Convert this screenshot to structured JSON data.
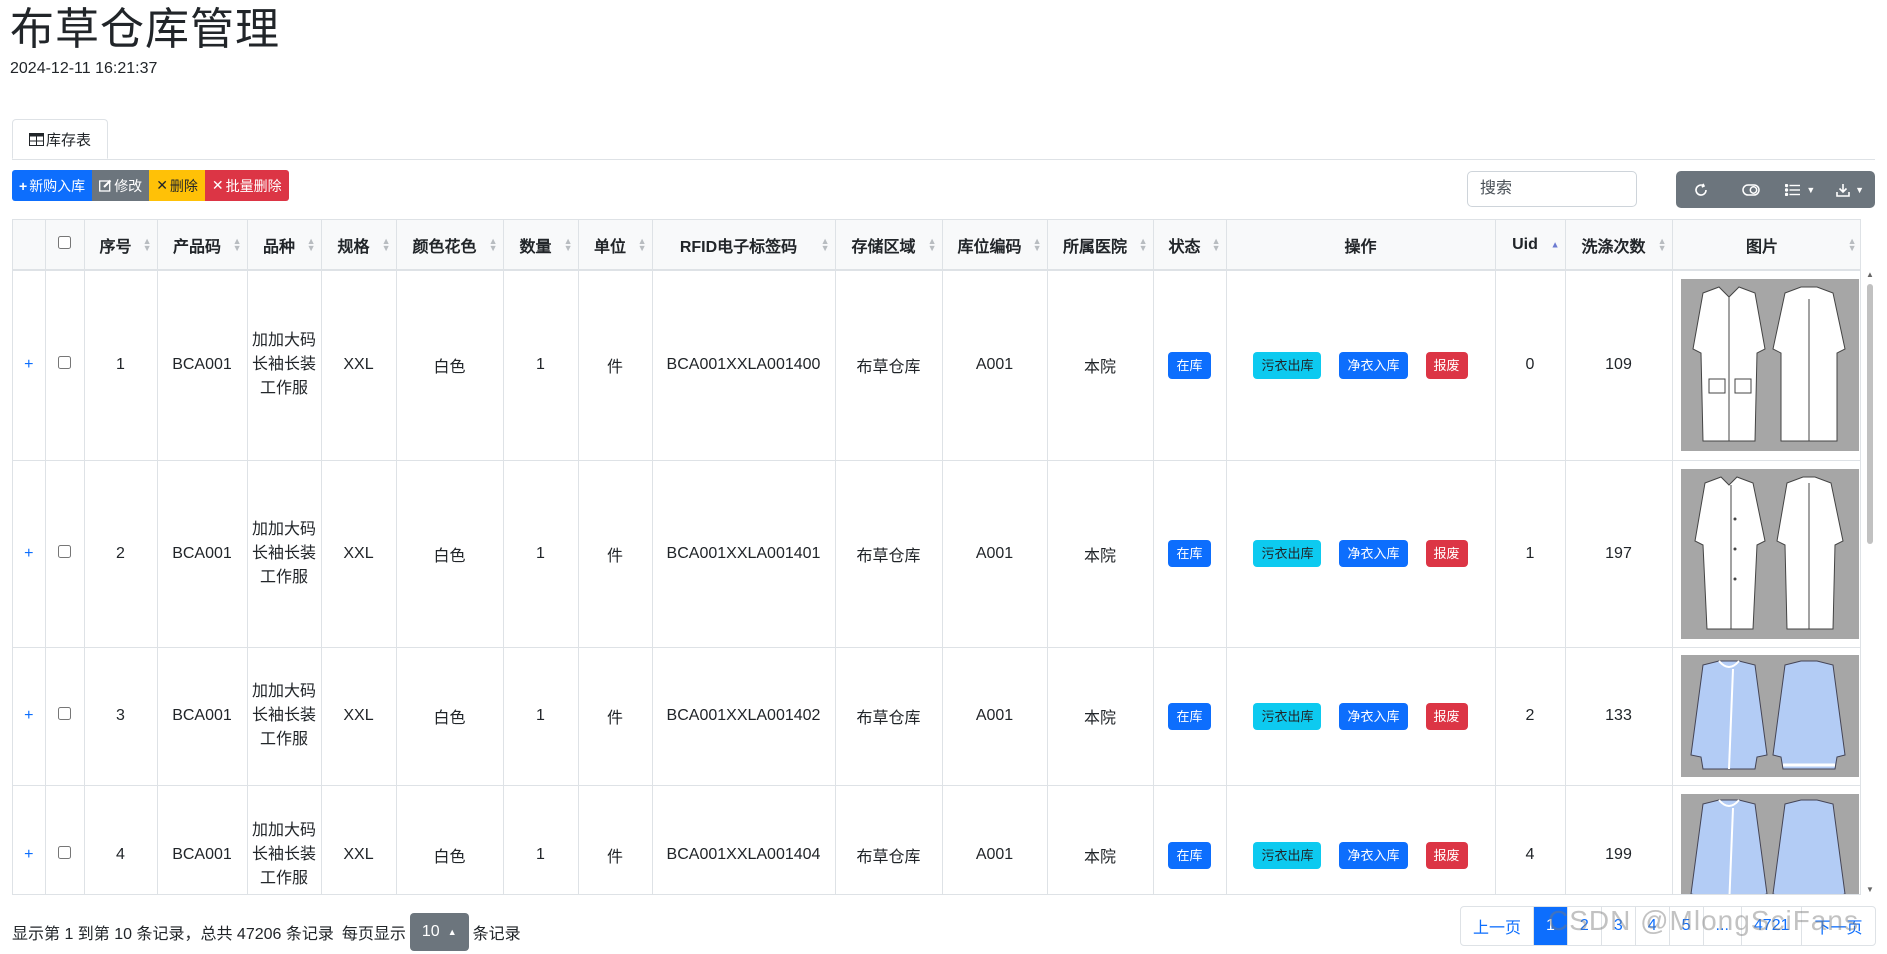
{
  "header": {
    "title": "布草仓库管理",
    "timestamp": "2024-12-11 16:21:37"
  },
  "tab": {
    "label": "库存表"
  },
  "toolbar": {
    "add_label": "新购入库",
    "edit_label": "修改",
    "delete_label": "删除",
    "batch_delete_label": "批量删除",
    "search_placeholder": "搜索"
  },
  "columns": [
    "序号",
    "产品码",
    "品种",
    "规格",
    "颜色花色",
    "数量",
    "单位",
    "RFID电子标签码",
    "存储区域",
    "库位编码",
    "所属医院",
    "状态",
    "操作",
    "Uid",
    "洗涤次数",
    "图片"
  ],
  "actions": {
    "dirty_out": "污衣出库",
    "clean_in": "净衣入库",
    "scrap": "报废"
  },
  "rows": [
    {
      "seq": "1",
      "code": "BCA001",
      "variety": "加加大码长袖长装工作服",
      "size": "XXL",
      "color": "白色",
      "qty": "1",
      "unit": "件",
      "rfid": "BCA001XXLA001400",
      "area": "布草仓库",
      "loc": "A001",
      "hospital": "本院",
      "status": "在库",
      "uid": "0",
      "washes": "109"
    },
    {
      "seq": "2",
      "code": "BCA001",
      "variety": "加加大码长袖长装工作服",
      "size": "XXL",
      "color": "白色",
      "qty": "1",
      "unit": "件",
      "rfid": "BCA001XXLA001401",
      "area": "布草仓库",
      "loc": "A001",
      "hospital": "本院",
      "status": "在库",
      "uid": "1",
      "washes": "197"
    },
    {
      "seq": "3",
      "code": "BCA001",
      "variety": "加加大码长袖长装工作服",
      "size": "XXL",
      "color": "白色",
      "qty": "1",
      "unit": "件",
      "rfid": "BCA001XXLA001402",
      "area": "布草仓库",
      "loc": "A001",
      "hospital": "本院",
      "status": "在库",
      "uid": "2",
      "washes": "133"
    },
    {
      "seq": "4",
      "code": "BCA001",
      "variety": "加加大码长袖长装工作服",
      "size": "XXL",
      "color": "白色",
      "qty": "1",
      "unit": "件",
      "rfid": "BCA001XXLA001404",
      "area": "布草仓库",
      "loc": "A001",
      "hospital": "本院",
      "status": "在库",
      "uid": "4",
      "washes": "199"
    }
  ],
  "footer": {
    "info_prefix": "显示第 1 到第 10 条记录，总共 47206 条记录",
    "per_page_label": "每页显示",
    "page_size": "10",
    "records_label": "条记录"
  },
  "pagination": [
    "上一页",
    "1",
    "2",
    "3",
    "4",
    "5",
    "...",
    "4721",
    "下一页"
  ],
  "watermark": "CSDN @MlongSciFans"
}
